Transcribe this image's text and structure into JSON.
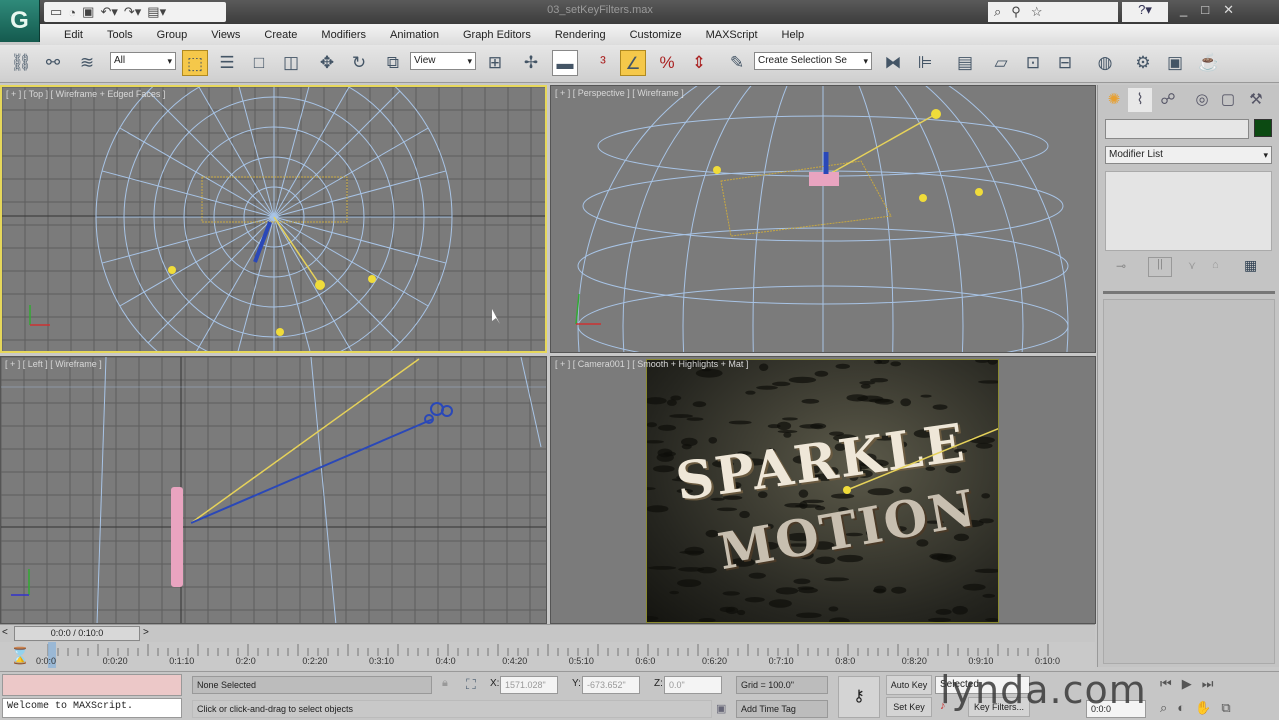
{
  "app": {
    "title": "03_setKeyFilters.max",
    "logo": "3ds Max logo"
  },
  "quick_access": [
    "new-icon",
    "open-icon",
    "save-icon",
    "undo-icon",
    "redo-icon",
    "project-icon"
  ],
  "menu": [
    "Edit",
    "Tools",
    "Group",
    "Views",
    "Create",
    "Modifiers",
    "Animation",
    "Graph Editors",
    "Rendering",
    "Customize",
    "MAXScript",
    "Help"
  ],
  "toolbar": {
    "selection_filter": "All",
    "reference_coord": "View",
    "named_selection": "Create Selection Se"
  },
  "viewports": [
    {
      "label": "[ + ] [ Top ] [ Wireframe + Edged Faces ]"
    },
    {
      "label": "[ + ] [ Perspective ] [ Wireframe ]"
    },
    {
      "label": "[ + ] [ Left ] [ Wireframe ]"
    },
    {
      "label": "[ + ] [ Camera001 ] [ Smooth + Highlights + Mat ]"
    }
  ],
  "render_text": {
    "line1": "SPARKLE",
    "line2": "MOTION"
  },
  "command_panel": {
    "name_value": "",
    "modifier_list": "Modifier List",
    "color": "#0c4a12"
  },
  "time_slider": {
    "label": "0:0:0 / 0:10:0",
    "progress": 0
  },
  "track_ticks": [
    "0:0:0",
    "0:0:20",
    "0:1:10",
    "0:2:0",
    "0:2:20",
    "0:3:10",
    "0:4:0",
    "0:4:20",
    "0:5:10",
    "0:6:0",
    "0:6:20",
    "0:7:10",
    "0:8:0",
    "0:8:20",
    "0:9:10",
    "0:10:0"
  ],
  "status": {
    "maxscript_output": "Welcome to MAXScript.",
    "selection": "None Selected",
    "prompt": "Click or click-and-drag to select objects",
    "x": "1571.028\"",
    "y": "-673.652\"",
    "z": "0.0\"",
    "grid": "Grid = 100.0\"",
    "add_time_tag": "Add Time Tag",
    "auto_key": "Auto Key",
    "set_key": "Set Key",
    "key_mode": "Selected",
    "key_filters": "Key Filters...",
    "frame": "0:0:0"
  },
  "watermark": "lynda.com"
}
